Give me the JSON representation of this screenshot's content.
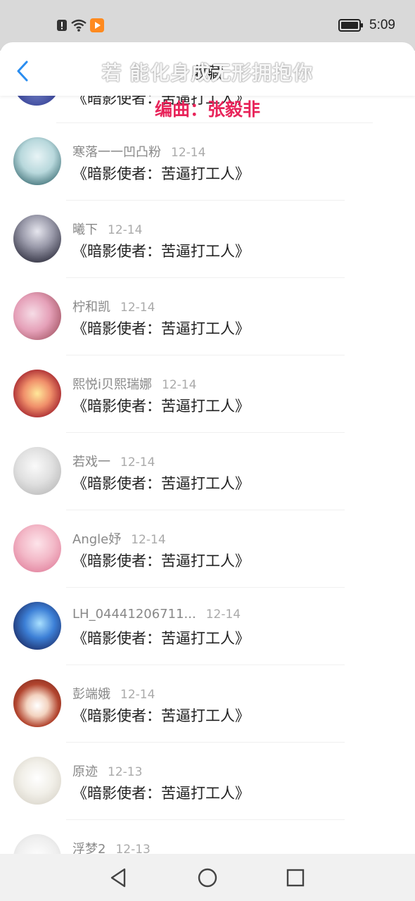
{
  "status_bar": {
    "time": "5:09"
  },
  "header": {
    "title": "收藏",
    "overlay_lyric": "若 能化身成无形拥抱你",
    "overlay_credit": "编曲：张毅非"
  },
  "partial_item": {
    "message": "《暗影使者：苦逼打工人》"
  },
  "items": [
    {
      "name": "寒落一一凹凸粉",
      "date": "12-14",
      "message": "《暗影使者：苦逼打工人》"
    },
    {
      "name": "曦下",
      "date": "12-14",
      "message": "《暗影使者：苦逼打工人》"
    },
    {
      "name": "柠和凯",
      "date": "12-14",
      "message": "《暗影使者：苦逼打工人》"
    },
    {
      "name": "熙悦i贝熙瑞娜",
      "date": "12-14",
      "message": "《暗影使者：苦逼打工人》"
    },
    {
      "name": "若戏一",
      "date": "12-14",
      "message": "《暗影使者：苦逼打工人》"
    },
    {
      "name": "Angle妤",
      "date": "12-14",
      "message": "《暗影使者：苦逼打工人》"
    },
    {
      "name": "LH_04441206711...",
      "date": "12-14",
      "message": "《暗影使者：苦逼打工人》"
    },
    {
      "name": "彭端娥",
      "date": "12-14",
      "message": "《暗影使者：苦逼打工人》"
    },
    {
      "name": "原迹",
      "date": "12-13",
      "message": "《暗影使者：苦逼打工人》"
    },
    {
      "name": "浮梦2",
      "date": "12-13",
      "message": ""
    }
  ]
}
